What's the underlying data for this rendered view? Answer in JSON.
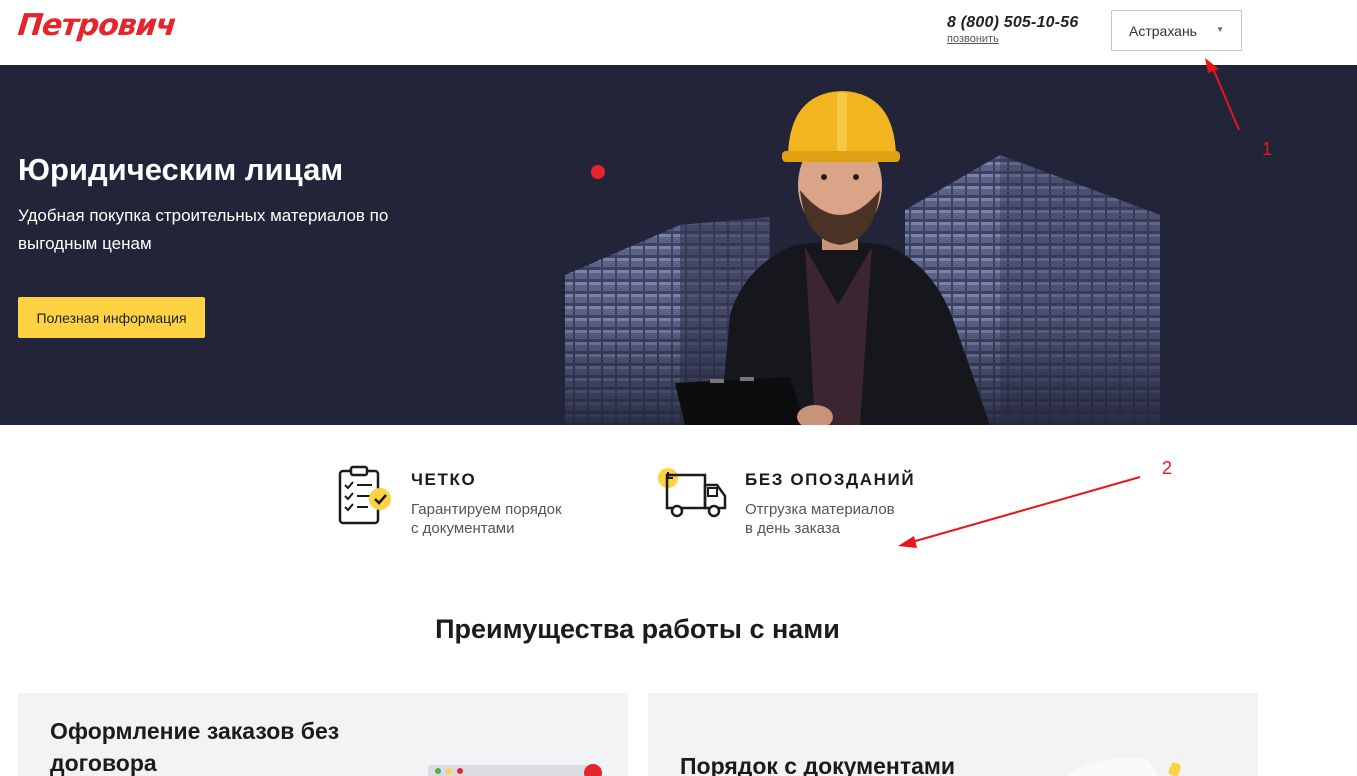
{
  "header": {
    "logo_text": "Петрович",
    "phone": "8 (800) 505-10-56",
    "call_label": "позвонить",
    "city": "Астрахань"
  },
  "hero": {
    "title": "Юридическим лицам",
    "subtitle": "Удобная покупка строительных материалов по выгодным ценам",
    "button_label": "Полезная информация"
  },
  "features": [
    {
      "title": "ЧЕТКО",
      "line1": "Гарантируем порядок",
      "line2": "с документами",
      "icon": "checklist-icon"
    },
    {
      "title": "БЕЗ ОПОЗДАНИЙ",
      "line1": "Отгрузка материалов",
      "line2": "в день заказа",
      "icon": "delivery-truck-icon"
    }
  ],
  "section": {
    "title": "Преимущества работы с нами"
  },
  "cards": [
    {
      "title": "Оформление заказов без договора"
    },
    {
      "title": "Порядок с документами"
    }
  ],
  "annotations": {
    "marker1": "1",
    "marker2": "2",
    "color": "#e8151b"
  },
  "colors": {
    "brand": "#e5242b",
    "accent": "#fdd343",
    "hero_bg": "#22253a"
  }
}
